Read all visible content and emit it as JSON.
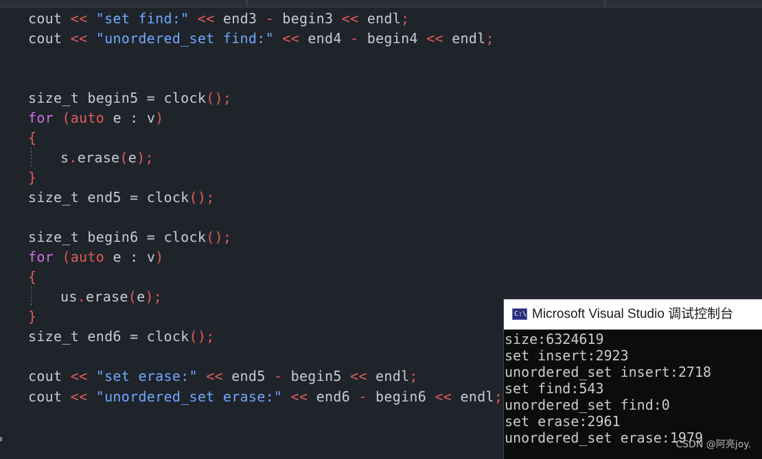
{
  "code": {
    "cout": "cout",
    "shl": "<<",
    "endl": "endl",
    "semi": ";",
    "minus": "-",
    "size_t": "size_t",
    "for": "for",
    "auto": "auto",
    "open_brace": "{",
    "close_brace": "}",
    "clock_call": "clock",
    "paren_open": "(",
    "paren_close": ")",
    "assign": "=",
    "colon": ":",
    "e": "e",
    "v": "v",
    "lines": {
      "l1_str": "\"set find:\"",
      "l1_end": "end3",
      "l1_begin": "begin3",
      "l2_str": "\"unordered_set find:\"",
      "l2_end": "end4",
      "l2_begin": "begin4",
      "begin5": "begin5",
      "end5": "end5",
      "s_erase_obj": "s",
      "erase_method": "erase",
      "dot": ".",
      "begin6": "begin6",
      "end6": "end6",
      "us_erase_obj": "us",
      "l3_str": "\"set erase:\"",
      "l4_str": "\"unordered_set erase:\""
    }
  },
  "console": {
    "title": "Microsoft Visual Studio 调试控制台",
    "icon_text": "C:\\",
    "icon": "console-app-icon",
    "output": [
      "size:6324619",
      "set insert:2923",
      "unordered_set insert:2718",
      "set find:543",
      "unordered_set find:0",
      "set erase:2961",
      "unordered_set erase:1979"
    ]
  },
  "watermark": "CSDN @阿亮joy.",
  "colors": {
    "editor_bg": "#1f242b",
    "keyword": "#d16fe0",
    "operator": "#e35b5b",
    "string": "#6fa8ff",
    "identifier": "#c7ccd4",
    "console_bg": "#0c0c0c"
  }
}
